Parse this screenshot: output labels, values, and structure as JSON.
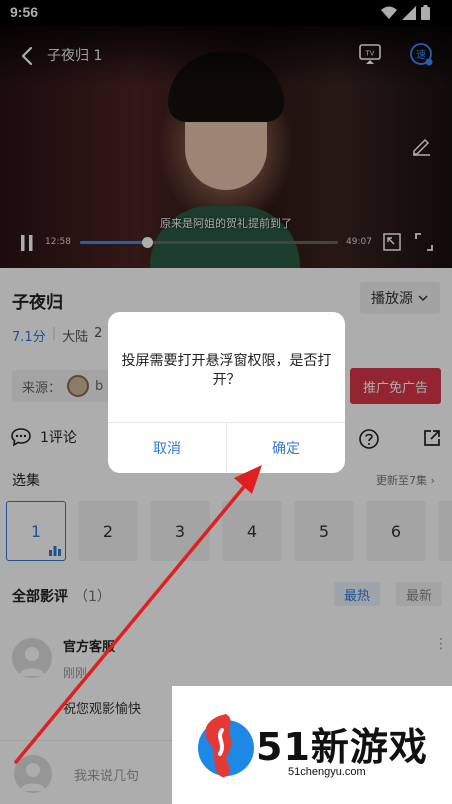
{
  "status_bar": {
    "time": "9:56"
  },
  "player": {
    "title": "子夜归 1",
    "subtitle": "原来是阿姐的贺礼提前到了",
    "time_current": "12:58",
    "time_total": "49:07",
    "progress": 0.26,
    "tv_label": "TV",
    "speed_label": "速"
  },
  "info": {
    "title": "子夜归",
    "source_button": "播放源",
    "rating": "7.1分",
    "region": "大陆",
    "year_partial": "2",
    "from_label": "来源：",
    "from_value": "b",
    "ad_button": "推广免广告"
  },
  "comments": {
    "label": "1评论"
  },
  "episodes": {
    "label": "选集",
    "more": "更新至7集 ›",
    "items": [
      "1",
      "2",
      "3",
      "4",
      "5",
      "6"
    ],
    "active": "1"
  },
  "reviews": {
    "label": "全部影评",
    "count": "（1）",
    "sort_hot": "最热",
    "sort_new": "最新",
    "item": {
      "name": "官方客服",
      "time": "刚刚",
      "text": "祝您观影愉快"
    }
  },
  "input": {
    "placeholder": "我来说几句"
  },
  "dialog": {
    "message": "投屏需要打开悬浮窗权限，是否打开？",
    "cancel": "取消",
    "confirm": "确定"
  },
  "watermark": {
    "title": "51新游戏",
    "subtitle": "51chengyu.com"
  },
  "colors": {
    "accent": "#2f7bd9",
    "ad_red": "#d9354a",
    "arrow_red": "#e02020"
  }
}
